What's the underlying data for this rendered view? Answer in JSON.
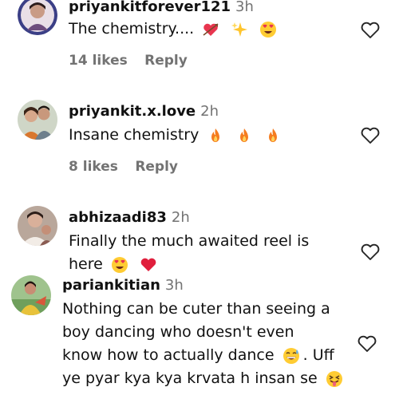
{
  "comments": [
    {
      "username": "priyankitforever121",
      "time": "3h",
      "text": "The chemistry....",
      "emojis": [
        "heart-arrow",
        "sparkles",
        "heart-eyes"
      ],
      "likes": "14 likes",
      "reply": "Reply"
    },
    {
      "username": "priyankit.x.love",
      "time": "2h",
      "text": "Insane chemistry",
      "emojis": [
        "fire",
        "fire",
        "fire"
      ],
      "likes": "8 likes",
      "reply": "Reply"
    },
    {
      "username": "abhizaadi83",
      "time": "2h",
      "line1": "Finally the much awaited reel is",
      "line2": "here",
      "emojis": [
        "heart-eyes",
        "red-heart"
      ]
    },
    {
      "username": "pariankitian",
      "time": "3h",
      "line1": "Nothing can be cuter than seeing a",
      "line2": "boy dancing who doesn't even",
      "line3": "know how to actually dance",
      "line3b": ". Uff",
      "line4": "ye pyar kya kya krvata h insan se",
      "emojis": [
        "grin-sweat",
        "tongue-face"
      ]
    }
  ],
  "colors": {
    "text": "#111111",
    "secondary": "#737373",
    "background": "#ffffff"
  }
}
